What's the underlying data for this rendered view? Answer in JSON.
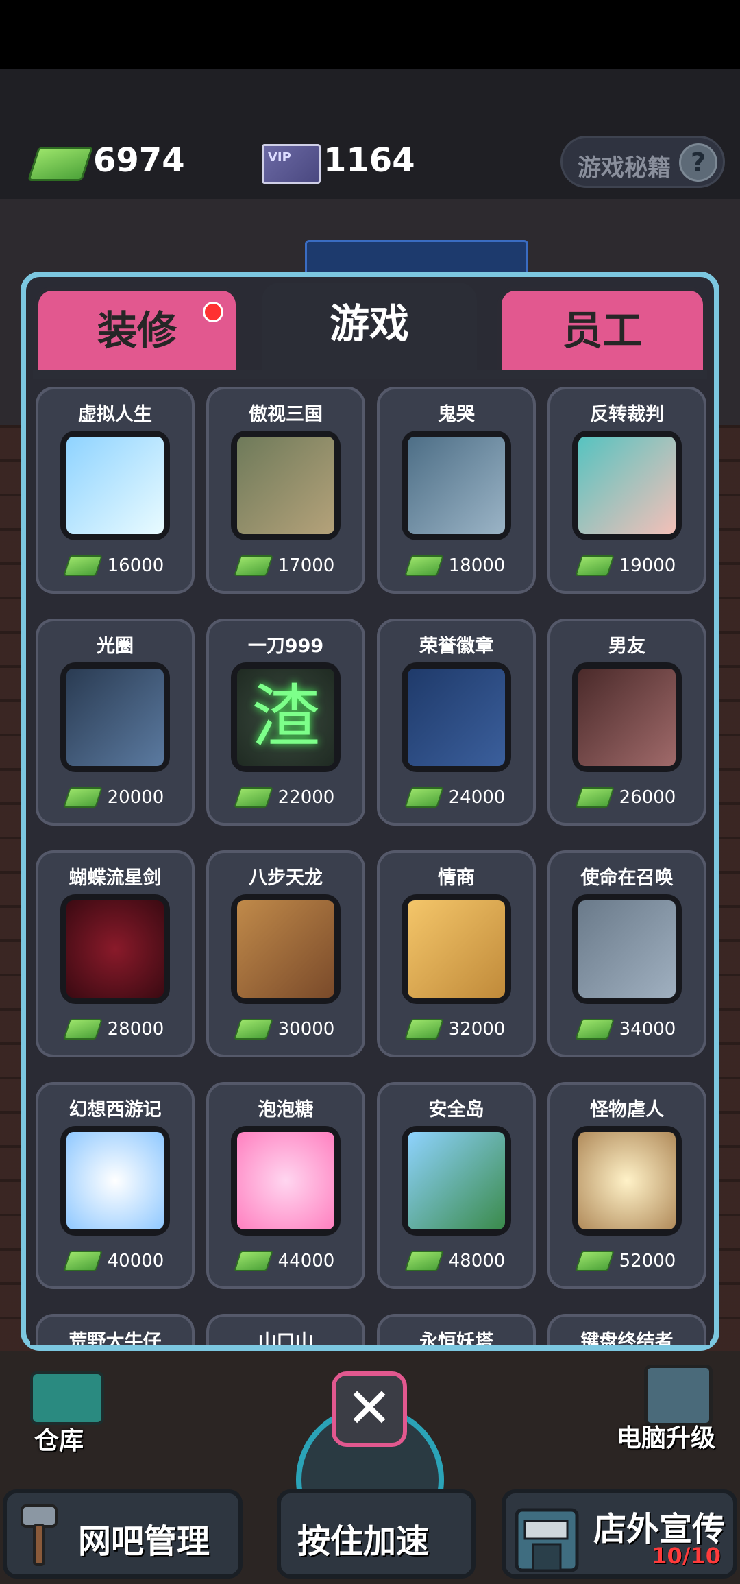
{
  "hud": {
    "cash": "6974",
    "vip_badge": "VIP",
    "vip_points": "1164",
    "cheats_label": "游戏秘籍",
    "cheats_icon": "question-icon"
  },
  "tabs": [
    {
      "label": "装修",
      "active": false,
      "has_notification": true
    },
    {
      "label": "游戏",
      "active": true
    },
    {
      "label": "员工",
      "active": false
    }
  ],
  "games": [
    {
      "name": "虚拟人生",
      "price": "16000"
    },
    {
      "name": "傲视三国",
      "price": "17000"
    },
    {
      "name": "鬼哭",
      "price": "18000"
    },
    {
      "name": "反转裁判",
      "price": "19000"
    },
    {
      "name": "光圈",
      "price": "20000"
    },
    {
      "name": "一刀999",
      "price": "22000",
      "art_text": "渣"
    },
    {
      "name": "荣誉徽章",
      "price": "24000"
    },
    {
      "name": "男友",
      "price": "26000"
    },
    {
      "name": "蝴蝶流星剑",
      "price": "28000"
    },
    {
      "name": "八步天龙",
      "price": "30000"
    },
    {
      "name": "情商",
      "price": "32000"
    },
    {
      "name": "使命在召唤",
      "price": "34000"
    },
    {
      "name": "幻想西游记",
      "price": "40000"
    },
    {
      "name": "泡泡糖",
      "price": "44000"
    },
    {
      "name": "安全岛",
      "price": "48000"
    },
    {
      "name": "怪物虐人",
      "price": "52000"
    },
    {
      "name": "荒野大牛仔",
      "price": ""
    },
    {
      "name": "山口山",
      "price": ""
    },
    {
      "name": "永恒妖塔",
      "price": ""
    },
    {
      "name": "键盘终结者",
      "price": ""
    }
  ],
  "bottom": {
    "warehouse_label": "仓库",
    "pc_upgrade_label": "电脑升级",
    "manage_label": "网吧管理",
    "speedup_label": "按住加速",
    "promo_label": "店外宣传",
    "promo_count": "10/10",
    "close_icon": "close-icon"
  },
  "colors": {
    "panel_border": "#7cc7e0",
    "tab_pink": "#e2588f",
    "card_bg": "#3a3f4d",
    "cash_green": "#6fc24a",
    "notification_red": "#ff3131"
  }
}
